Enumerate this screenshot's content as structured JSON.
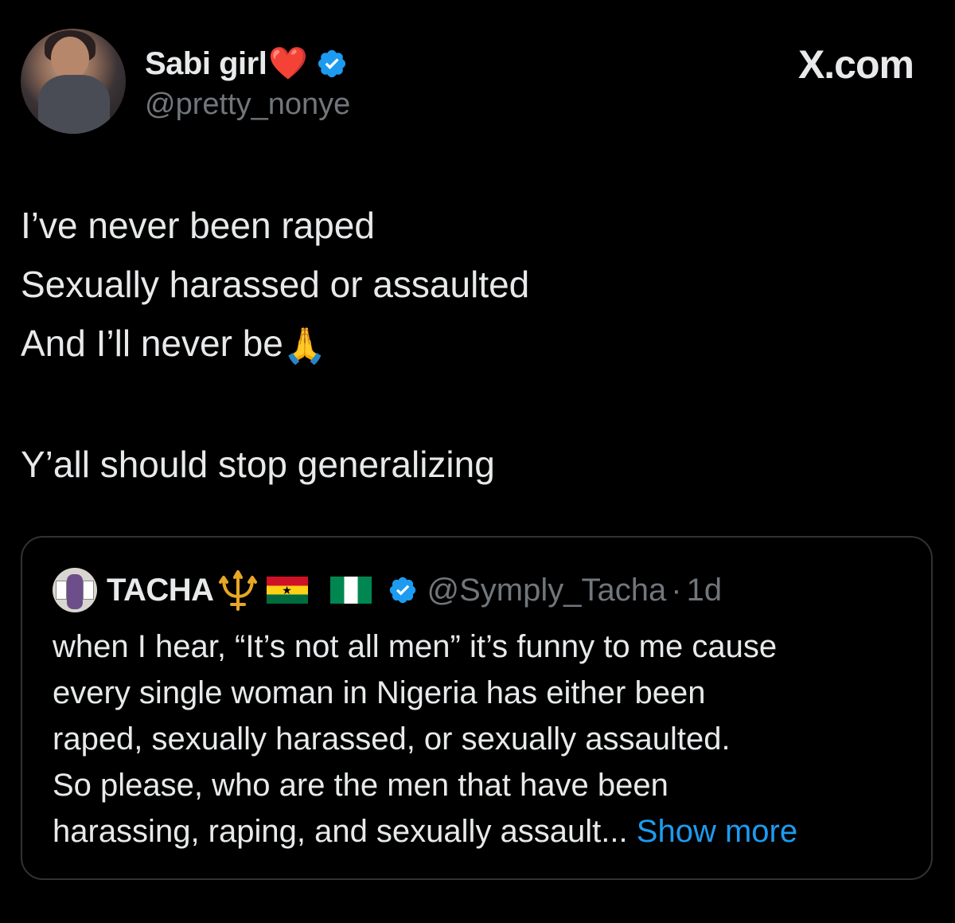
{
  "post": {
    "author": {
      "display_name": "Sabi girl",
      "name_emoji": "❤️",
      "verified_icon": "verified-badge-icon",
      "handle": "@pretty_nonye"
    },
    "source_label": "X.com",
    "text_lines": [
      "I’ve never been raped",
      "Sexually harassed or assaulted",
      "And I’ll never be",
      "Y’all should stop generalizing"
    ],
    "text_emoji": "🙏"
  },
  "quote": {
    "author": {
      "display_name": "TACHA",
      "name_icons": [
        "trident-icon",
        "ghana-flag-icon",
        "nigeria-flag-icon"
      ],
      "verified_icon": "verified-badge-icon",
      "handle": "@Symply_Tacha",
      "separator": "·",
      "time": "1d"
    },
    "text_lines": [
      "when I hear, “It’s not all men” it’s funny to me cause",
      "every single woman in Nigeria has either been",
      "raped, sexually harassed, or sexually assaulted.",
      "So please, who are the men that have been",
      "harassing, raping, and sexually assault..."
    ],
    "show_more_label": "Show more"
  },
  "colors": {
    "background": "#000000",
    "text_primary": "#e7e9ea",
    "text_secondary": "#71767b",
    "link": "#1d9bf0",
    "verified": "#1d9bf0",
    "border": "#2f3336"
  }
}
